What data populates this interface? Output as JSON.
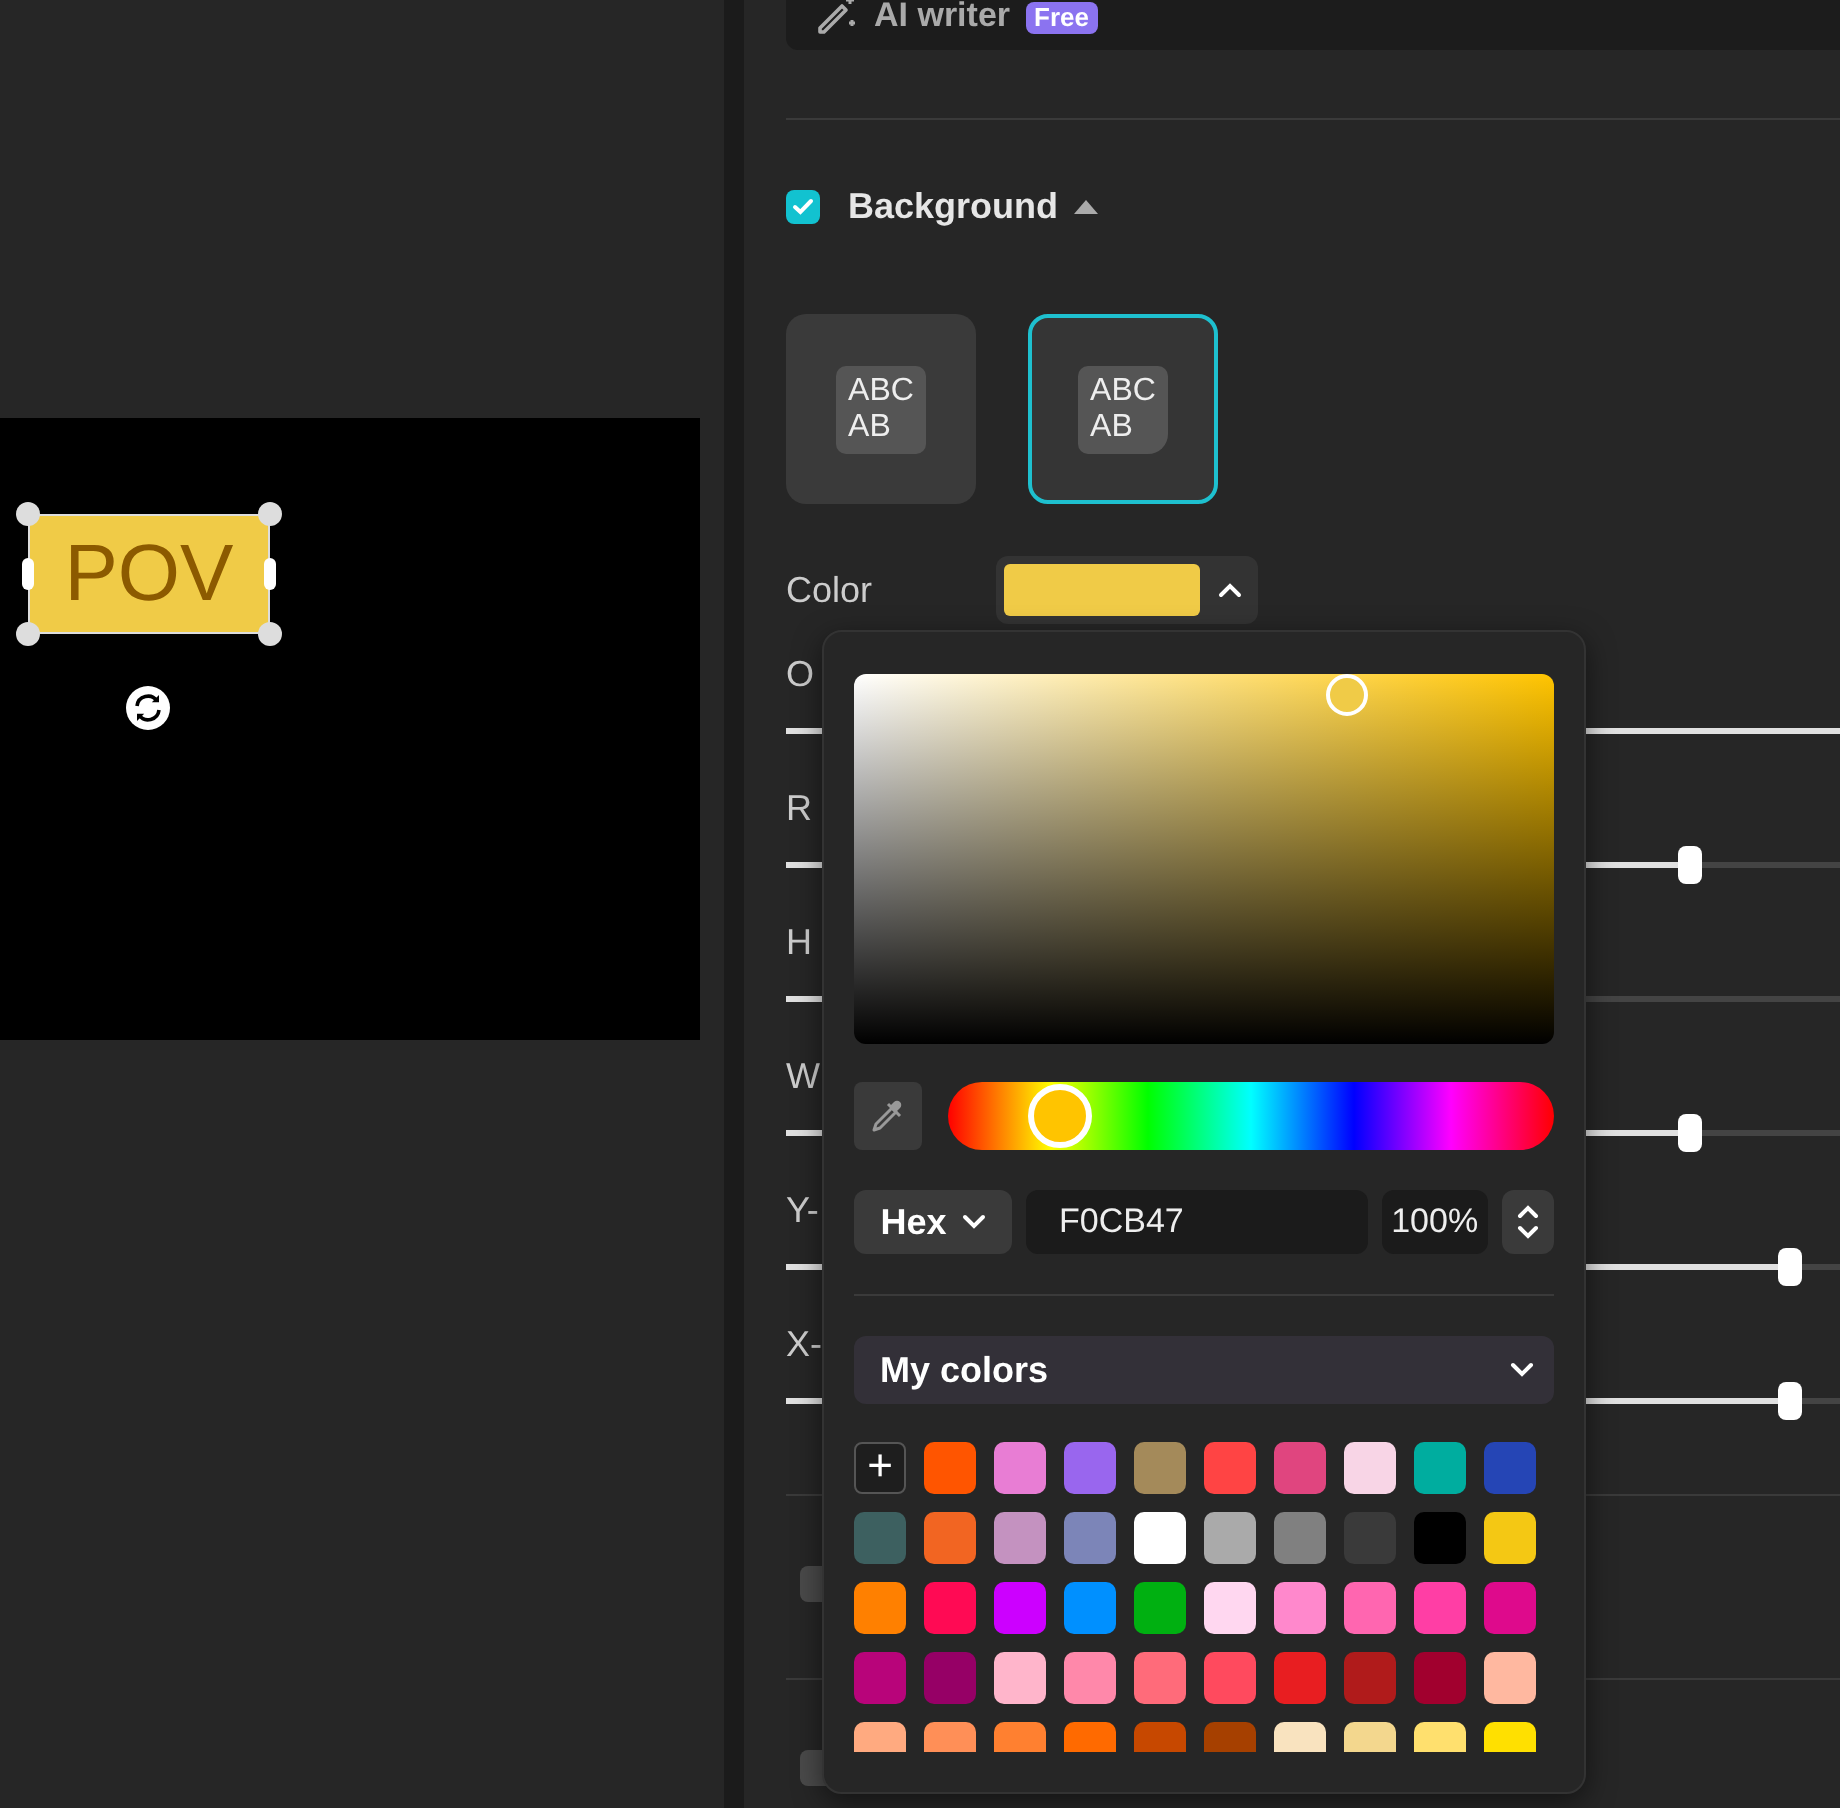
{
  "canvas": {
    "caption": "POV",
    "selected": true
  },
  "panel": {
    "ai_writer": {
      "label": "AI writer",
      "badge": "Free"
    },
    "background": {
      "label": "Background",
      "checked": true,
      "expanded": true
    },
    "styles": [
      {
        "kind": "full",
        "text": "ABC\nAB",
        "selected": false
      },
      {
        "kind": "wrap",
        "text": "ABC\nAB",
        "selected": true
      }
    ],
    "color": {
      "label": "Color",
      "expanded": true
    },
    "sliders": [
      {
        "label": "O",
        "level": 1
      },
      {
        "label": "R",
        "level": 0.797
      },
      {
        "label": "H",
        "level": 0.3
      },
      {
        "label": "W",
        "level": 0.797
      },
      {
        "label": "Y-",
        "level": 0.885
      },
      {
        "label": "X-",
        "level": 0.885
      }
    ],
    "sections": [
      {
        "checked": false
      },
      {
        "checked": false
      }
    ]
  },
  "color_picker": {
    "hue": {
      "level": 0.184
    },
    "mode": "Hex",
    "hex": "F0CB47",
    "opacity": "100%",
    "palette": "My colors",
    "add": "+",
    "swatches": [
      {
        "color": "#ff5500"
      },
      {
        "color": "#e87dd4"
      },
      {
        "color": "#9966ee"
      },
      {
        "color": "#a48a5a"
      },
      {
        "color": "#ff4444"
      },
      {
        "color": "#e0457f"
      },
      {
        "color": "#f8d5e6"
      },
      {
        "color": "#00ad9f"
      },
      {
        "color": "#2545b5"
      },
      {
        "color": "#3d6060"
      },
      {
        "color": "#f26522"
      },
      {
        "color": "#c492c0"
      },
      {
        "color": "#7c85b8"
      },
      {
        "color": "#ffffff"
      },
      {
        "color": "#aaaaaa"
      },
      {
        "color": "#808080"
      },
      {
        "color": "#3a3a3a"
      },
      {
        "color": "#000000"
      },
      {
        "color": "#f4c814"
      },
      {
        "color": "#ff8000"
      },
      {
        "color": "#ff0a54"
      },
      {
        "color": "#cc00ff"
      },
      {
        "color": "#0090ff"
      },
      {
        "color": "#00b011"
      },
      {
        "color": "#ffd7f0"
      },
      {
        "color": "#ff88cc"
      },
      {
        "color": "#ff66b0"
      },
      {
        "color": "#ff3ea5"
      },
      {
        "color": "#de0a8c"
      },
      {
        "color": "#b8047a"
      },
      {
        "color": "#960066"
      },
      {
        "color": "#ffb5cb"
      },
      {
        "color": "#ff88aa"
      },
      {
        "color": "#ff6b7a"
      },
      {
        "color": "#ff4a5e"
      },
      {
        "color": "#e81e21"
      },
      {
        "color": "#b01b1b"
      },
      {
        "color": "#a1002e"
      },
      {
        "color": "#ffb8a0"
      },
      {
        "color": "#ffaa80"
      },
      {
        "color": "#ff8f57"
      },
      {
        "color": "#ff8030"
      },
      {
        "color": "#ff6a00"
      },
      {
        "color": "#c74800"
      },
      {
        "color": "#a64000"
      },
      {
        "color": "#f9e3bf"
      },
      {
        "color": "#f3d78e"
      },
      {
        "color": "#ffe06e"
      },
      {
        "color": "#ffe000"
      }
    ]
  }
}
